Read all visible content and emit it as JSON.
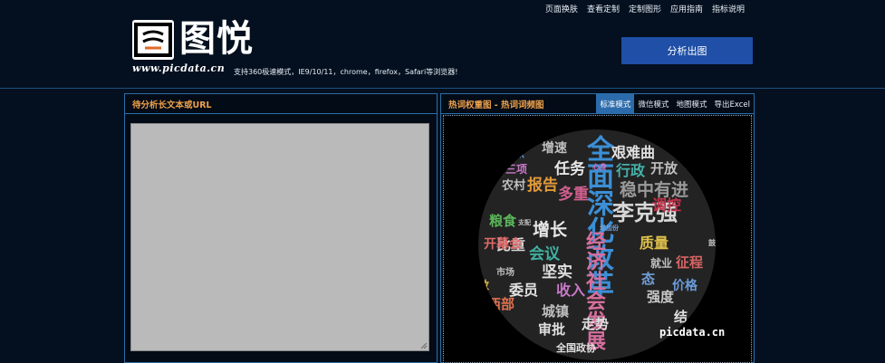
{
  "top_nav": [
    "页面换肤",
    "查看定制",
    "定制图形",
    "应用指南",
    "指标说明"
  ],
  "brand": {
    "name": "图悦",
    "url": "www.picdata.cn"
  },
  "support_text": "支持360极速模式，IE9/10/11，chrome，firefox，Safari等浏览器!",
  "analyze_button": "分析出图",
  "left_panel": {
    "title": "待分析长文本或URL"
  },
  "right_panel": {
    "title": "热词权重图 - 热词词频图",
    "modes": [
      "标准模式",
      "微信模式",
      "地图模式",
      "导出Excel"
    ],
    "active_mode": "标准模式"
  },
  "watermark": "picdata.cn",
  "word_cloud": [
    {
      "t": "全面深化改革",
      "c": "#3b8fd6",
      "s": 30,
      "v": true
    },
    {
      "t": "艰难曲",
      "c": "#e0e0e0",
      "s": 16
    },
    {
      "t": "增速",
      "c": "#bfbfbf",
      "s": 14
    },
    {
      "t": "焦",
      "c": "#5a8fd0",
      "s": 13
    },
    {
      "t": "三项",
      "c": "#c878c8",
      "s": 12
    },
    {
      "t": "任务",
      "c": "#e6e6e6",
      "s": 17
    },
    {
      "t": "行政",
      "c": "#45b0a8",
      "s": 16
    },
    {
      "t": "开放",
      "c": "#bfbfbf",
      "s": 15
    },
    {
      "t": "稳中有进",
      "c": "#9a9a9a",
      "s": 19
    },
    {
      "t": "报告",
      "c": "#e39a3a",
      "s": 17
    },
    {
      "t": "多重",
      "c": "#d0608e",
      "s": 17
    },
    {
      "t": "李克强",
      "c": "#d8d8d8",
      "s": 24
    },
    {
      "t": "农村",
      "c": "#bfbfbf",
      "s": 13
    },
    {
      "t": "粮食",
      "c": "#5ab55a",
      "s": 15
    },
    {
      "t": "增长",
      "c": "#e8e8e8",
      "s": 19
    },
    {
      "t": "调控",
      "c": "#c8324b",
      "s": 16
    },
    {
      "t": "经济社会发展",
      "c": "#d66f9e",
      "s": 22,
      "v": true
    },
    {
      "t": "质量",
      "c": "#e0c04a",
      "s": 16
    },
    {
      "t": "比重",
      "c": "#d8d8d8",
      "s": 16
    },
    {
      "t": "就业",
      "c": "#bfbfbf",
      "s": 12
    },
    {
      "t": "征程",
      "c": "#d86464",
      "s": 15
    },
    {
      "t": "开幕会",
      "c": "#e06a6a",
      "s": 14
    },
    {
      "t": "会议",
      "c": "#40b0a0",
      "s": 17
    },
    {
      "t": "市场",
      "c": "#bfbfbf",
      "s": 10
    },
    {
      "t": "坚实",
      "c": "#e0e0e0",
      "s": 17
    },
    {
      "t": "态",
      "c": "#6fa0d8",
      "s": 15
    },
    {
      "t": "强度",
      "c": "#c8c8c8",
      "s": 15
    },
    {
      "t": "价格",
      "c": "#6a9bd8",
      "s": 14
    },
    {
      "t": "委员",
      "c": "#e0e0e0",
      "s": 16
    },
    {
      "t": "收入",
      "c": "#c878c8",
      "s": 16
    },
    {
      "t": "西部",
      "c": "#e07050",
      "s": 15
    },
    {
      "t": "城镇",
      "c": "#bfbfbf",
      "s": 15
    },
    {
      "t": "审批",
      "c": "#e0e0e0",
      "s": 15
    },
    {
      "t": "走势",
      "c": "#e0e0e0",
      "s": 15
    },
    {
      "t": "全国政协",
      "c": "#e0e0e0",
      "s": 11
    },
    {
      "t": "结",
      "c": "#e0e0e0",
      "s": 15
    },
    {
      "t": "心身",
      "c": "#c878c8",
      "s": 8
    },
    {
      "t": "支配",
      "c": "#bfbfbf",
      "s": 7
    },
    {
      "t": "增加份",
      "c": "#6fa0d8",
      "s": 7
    },
    {
      "t": "鼓",
      "c": "#c8c8c8",
      "s": 8
    },
    {
      "t": "敦",
      "c": "#e0c04a",
      "s": 12
    }
  ]
}
